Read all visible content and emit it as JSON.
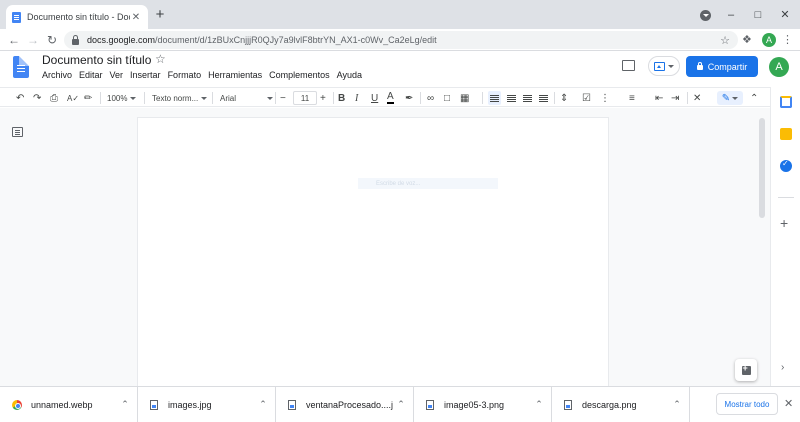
{
  "browser": {
    "tab_title": "Documento sin título - Docume",
    "new_tab": "+",
    "url_host": "docs.google.com",
    "url_path": "/document/d/1zBUxCnjjjR0QJy7a9lvlF8btrYN_AX1-c0Wv_Ca2eLg/edit",
    "profile_initial": "A"
  },
  "docs": {
    "title": "Documento sin título",
    "menu": [
      "Archivo",
      "Editar",
      "Ver",
      "Insertar",
      "Formato",
      "Herramientas",
      "Complementos",
      "Ayuda"
    ],
    "share_label": "Compartir",
    "avatar_initial": "A"
  },
  "toolbar": {
    "zoom": "100%",
    "style": "Texto norm...",
    "font": "Arial",
    "font_size": "11"
  },
  "canvas": {
    "placeholder": "Escribe de voz..."
  },
  "downloads": {
    "items": [
      "unnamed.webp",
      "images.jpg",
      "ventanaProcesado....jpg",
      "image05-3.png",
      "descarga.png"
    ],
    "show_all": "Mostrar todo"
  },
  "colors": {
    "accent": "#1a73e8",
    "docs_blue": "#4285f4",
    "avatar_green": "#34a853"
  }
}
